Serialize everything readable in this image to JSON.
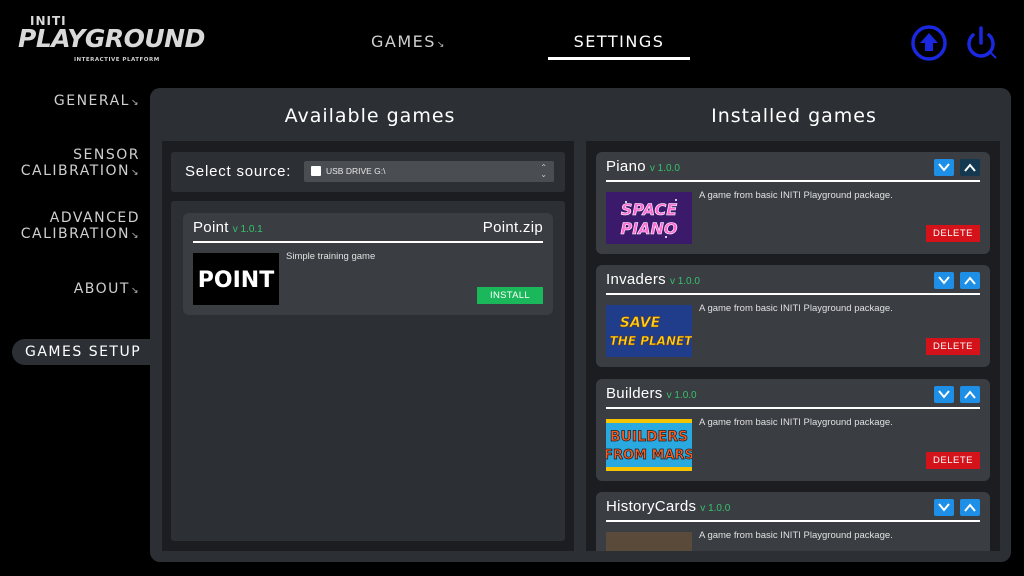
{
  "logo": {
    "brand": "INITI",
    "name": "PLAYGROUND",
    "tagline": "INTERACTIVE PLATFORM"
  },
  "topnav": {
    "tabs": [
      {
        "label": "GAMES",
        "active": false
      },
      {
        "label": "SETTINGS",
        "active": true
      }
    ]
  },
  "top_icons": [
    "update-icon",
    "power-icon"
  ],
  "sidemenu": {
    "items": [
      {
        "label": "GENERAL"
      },
      {
        "label": "SENSOR\nCALIBRATION"
      },
      {
        "label": "ADVANCED\nCALIBRATION"
      },
      {
        "label": "ABOUT"
      },
      {
        "label": "GAMES SETUP",
        "active": true
      }
    ]
  },
  "available": {
    "title": "Available games",
    "source_label": "Select source:",
    "source_value": "USB DRIVE G:\\",
    "games": [
      {
        "name": "Point",
        "version": "v 1.0.1",
        "file": "Point.zip",
        "thumb_text": "POINT",
        "description": "Simple training game",
        "action": "INSTALL"
      }
    ]
  },
  "installed": {
    "title": "Installed games",
    "games": [
      {
        "name": "Piano",
        "version": "v 1.0.0",
        "thumb_text": [
          "SPACE",
          "PIANO"
        ],
        "description": "A game from basic INITI Playground package.",
        "action": "DELETE"
      },
      {
        "name": "Invaders",
        "version": "v 1.0.0",
        "thumb_text": [
          "SAVE",
          "THE PLANET"
        ],
        "description": "A game from basic INITI Playground package.",
        "action": "DELETE"
      },
      {
        "name": "Builders",
        "version": "v 1.0.0",
        "thumb_text": [
          "BUILDERS",
          "FROM MARS"
        ],
        "description": "A game from basic INITI Playground package.",
        "action": "DELETE"
      },
      {
        "name": "HistoryCards",
        "version": "v 1.0.0",
        "description": "A game from basic INITI Playground package."
      }
    ]
  },
  "colors": {
    "accent_blue": "#1e8fe6",
    "install_green": "#1ab85a",
    "delete_red": "#d4121a",
    "version_green": "#37c26c",
    "panel": "#2c3035"
  }
}
